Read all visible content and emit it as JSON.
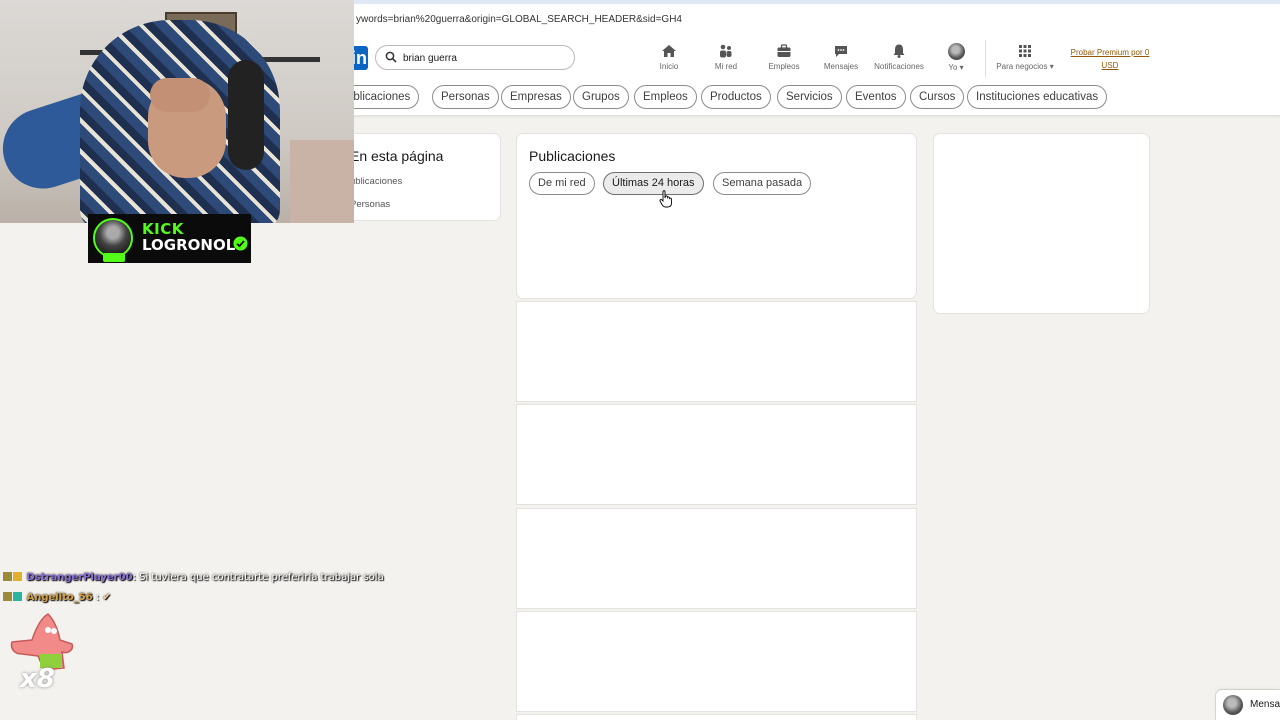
{
  "browser": {
    "url": "ywords=brian%20guerra&origin=GLOBAL_SEARCH_HEADER&sid=GH4"
  },
  "header": {
    "logo_text": "in",
    "search_value": "brian guerra",
    "nav": [
      {
        "label": "Inicio",
        "icon": "home-icon"
      },
      {
        "label": "Mi red",
        "icon": "network-icon"
      },
      {
        "label": "Empleos",
        "icon": "briefcase-icon"
      },
      {
        "label": "Mensajes",
        "icon": "message-icon"
      },
      {
        "label": "Notificaciones",
        "icon": "bell-icon"
      },
      {
        "label": "Yo",
        "icon": "avatar"
      }
    ],
    "business_label": "Para negocios",
    "premium_line1": "Probar Premium por 0",
    "premium_line2": "USD"
  },
  "filters": [
    "ublicaciones",
    "Personas",
    "Empresas",
    "Grupos",
    "Empleos",
    "Productos",
    "Servicios",
    "Eventos",
    "Cursos",
    "Instituciones educativas"
  ],
  "left_card": {
    "title": "En esta página",
    "links": [
      "ublicaciones",
      "Personas"
    ]
  },
  "main_card": {
    "title": "Publicaciones",
    "chips": [
      "De mi red",
      "Últimas 24 horas",
      "Semana pasada"
    ],
    "active_chip": "Últimas 24 horas"
  },
  "stream_overlay": {
    "platform": "KICK",
    "channel": "LOGRONOL",
    "accent": "#53fc18",
    "chat": [
      {
        "user": "DstrangerPlayer00",
        "message": "Si tuviera que contratarte preferiría trabajar sola"
      },
      {
        "user": "Angelito_56",
        "message": ""
      }
    ],
    "emote_multiplier": "x8"
  },
  "messaging": {
    "label": "Mensa"
  },
  "colors": {
    "linkedin_blue": "#0a66c2",
    "premium": "#915907",
    "background": "#f4f2ee"
  }
}
